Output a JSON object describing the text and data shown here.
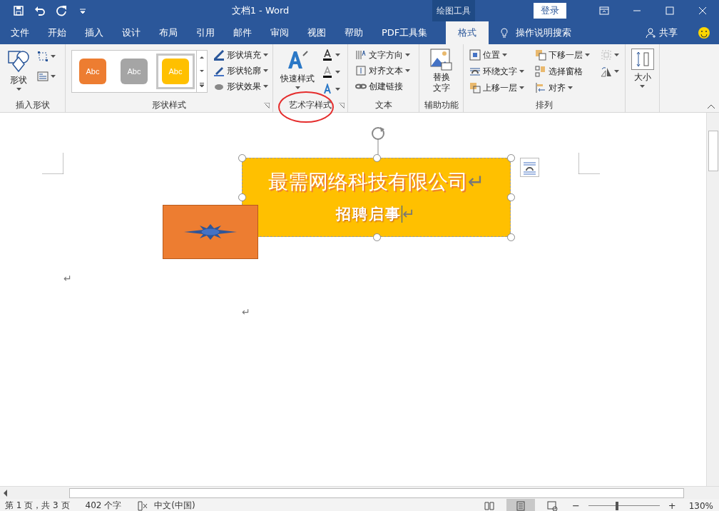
{
  "window": {
    "title": "文档1  -  Word",
    "context_tab": "绘图工具",
    "login": "登录"
  },
  "tabs": [
    {
      "label": "文件",
      "selected": false
    },
    {
      "label": "开始",
      "selected": false
    },
    {
      "label": "插入",
      "selected": false
    },
    {
      "label": "设计",
      "selected": false
    },
    {
      "label": "布局",
      "selected": false
    },
    {
      "label": "引用",
      "selected": false
    },
    {
      "label": "邮件",
      "selected": false
    },
    {
      "label": "审阅",
      "selected": false
    },
    {
      "label": "视图",
      "selected": false
    },
    {
      "label": "帮助",
      "selected": false
    },
    {
      "label": "PDF工具集",
      "selected": false
    },
    {
      "label": "格式",
      "selected": true
    }
  ],
  "tell_me": "操作说明搜索",
  "share": "共享",
  "ribbon": {
    "insert_shapes": {
      "label": "插入形状",
      "shapes_button": "形状"
    },
    "shape_styles": {
      "label": "形状样式",
      "presets": [
        {
          "text": "Abc",
          "color": "#ed7d31",
          "selected": false
        },
        {
          "text": "Abc",
          "color": "#a5a5a5",
          "selected": false
        },
        {
          "text": "Abc",
          "color": "#ffc000",
          "selected": true
        }
      ],
      "commands": [
        "形状填充",
        "形状轮廓",
        "形状效果"
      ]
    },
    "wordart": {
      "label": "艺术字样式",
      "quick_styles": "快速样式"
    },
    "text": {
      "label": "文本",
      "commands": [
        "文字方向",
        "对齐文本",
        "创建链接"
      ]
    },
    "accessibility": {
      "label": "辅助功能",
      "alt_text": "替换文字"
    },
    "arrange": {
      "label": "排列",
      "commands": [
        "位置",
        "环绕文字",
        "上移一层",
        "下移一层",
        "选择窗格",
        "对齐"
      ]
    },
    "size": {
      "label": "大小"
    }
  },
  "document": {
    "textbox": {
      "lines": [
        {
          "text": "最需网络科技有限公司",
          "mark": "↵"
        },
        {
          "text": "招聘启事",
          "mark": "↵"
        }
      ]
    },
    "paragraph_marks": [
      "↵",
      "↵"
    ]
  },
  "status_bar": {
    "items": [
      "第 1 页，共 3 页",
      "402 个字",
      "中文(中国)"
    ],
    "views": [
      {
        "kind": "read",
        "selected": false
      },
      {
        "kind": "print",
        "selected": true
      },
      {
        "kind": "web",
        "selected": false
      }
    ],
    "zoom_out": "−",
    "zoom_in": "+",
    "zoom": {
      "level": 0.4
    },
    "zoom_text": "130%"
  }
}
